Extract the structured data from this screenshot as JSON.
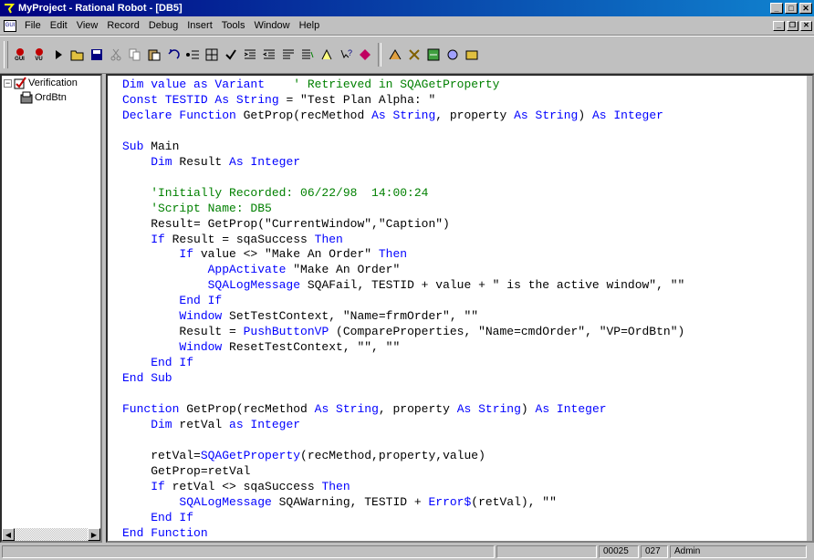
{
  "window": {
    "title": "MyProject - Rational Robot - [DB5]",
    "min_label": "_",
    "max_label": "□",
    "close_label": "✕"
  },
  "menubar": {
    "doc_icon_label": "GUI",
    "items": [
      "File",
      "Edit",
      "View",
      "Record",
      "Debug",
      "Insert",
      "Tools",
      "Window",
      "Help"
    ],
    "mdi_min": "_",
    "mdi_restore": "❐",
    "mdi_close": "✕"
  },
  "toolbar": {
    "gui_label": "GUI",
    "vu_label": "VU"
  },
  "tree": {
    "root": {
      "label": "Verification",
      "expander": "−"
    },
    "child": {
      "label": "OrdBtn"
    }
  },
  "editor": {
    "lines": [
      [
        {
          "t": "Dim value ",
          "c": "kw"
        },
        {
          "t": "as Variant",
          "c": "kw"
        },
        {
          "t": "    ' Retrieved in SQAGetProperty",
          "c": "cm"
        }
      ],
      [
        {
          "t": "Const TESTID ",
          "c": "kw"
        },
        {
          "t": "As String",
          "c": "kw"
        },
        {
          "t": " = \"Test Plan Alpha: \"",
          "c": ""
        }
      ],
      [
        {
          "t": "Declare Function",
          "c": "kw"
        },
        {
          "t": " GetProp(recMethod ",
          "c": ""
        },
        {
          "t": "As String",
          "c": "kw"
        },
        {
          "t": ", property ",
          "c": ""
        },
        {
          "t": "As String",
          "c": "kw"
        },
        {
          "t": ") ",
          "c": ""
        },
        {
          "t": "As Integer",
          "c": "kw"
        }
      ],
      [],
      [
        {
          "t": "Sub",
          "c": "kw"
        },
        {
          "t": " Main",
          "c": ""
        }
      ],
      [
        {
          "t": "    Dim",
          "c": "kw"
        },
        {
          "t": " Result ",
          "c": ""
        },
        {
          "t": "As Integer",
          "c": "kw"
        }
      ],
      [],
      [
        {
          "t": "    'Initially Recorded: 06/22/98  14:00:24",
          "c": "cm"
        }
      ],
      [
        {
          "t": "    'Script Name: DB5",
          "c": "cm"
        }
      ],
      [
        {
          "t": "    Result= GetProp(\"CurrentWindow\",\"Caption\")",
          "c": ""
        }
      ],
      [
        {
          "t": "    If",
          "c": "kw"
        },
        {
          "t": " Result = sqaSuccess ",
          "c": ""
        },
        {
          "t": "Then",
          "c": "kw"
        }
      ],
      [
        {
          "t": "        If",
          "c": "kw"
        },
        {
          "t": " value <> \"Make An Order\" ",
          "c": ""
        },
        {
          "t": "Then",
          "c": "kw"
        }
      ],
      [
        {
          "t": "            AppActivate",
          "c": "kw"
        },
        {
          "t": " \"Make An Order\"",
          "c": ""
        }
      ],
      [
        {
          "t": "            SQALogMessage",
          "c": "kw"
        },
        {
          "t": " SQAFail, TESTID + value + \" is the active window\", \"\"",
          "c": ""
        }
      ],
      [
        {
          "t": "        End If",
          "c": "kw"
        }
      ],
      [
        {
          "t": "        Window",
          "c": "kw"
        },
        {
          "t": " SetTestContext, \"Name=frmOrder\", \"\"",
          "c": ""
        }
      ],
      [
        {
          "t": "        Result = ",
          "c": ""
        },
        {
          "t": "PushButtonVP",
          "c": "kw"
        },
        {
          "t": " (CompareProperties, \"Name=cmdOrder\", \"VP=OrdBtn\")",
          "c": ""
        }
      ],
      [
        {
          "t": "        Window",
          "c": "kw"
        },
        {
          "t": " ResetTestContext, \"\", \"\"",
          "c": ""
        }
      ],
      [
        {
          "t": "    End If",
          "c": "kw"
        }
      ],
      [
        {
          "t": "End Sub",
          "c": "kw"
        }
      ],
      [],
      [
        {
          "t": "Function",
          "c": "kw"
        },
        {
          "t": " GetProp(recMethod ",
          "c": ""
        },
        {
          "t": "As String",
          "c": "kw"
        },
        {
          "t": ", property ",
          "c": ""
        },
        {
          "t": "As String",
          "c": "kw"
        },
        {
          "t": ") ",
          "c": ""
        },
        {
          "t": "As Integer",
          "c": "kw"
        }
      ],
      [
        {
          "t": "    Dim",
          "c": "kw"
        },
        {
          "t": " retVal ",
          "c": ""
        },
        {
          "t": "as Integer",
          "c": "kw"
        }
      ],
      [],
      [
        {
          "t": "    retVal=",
          "c": ""
        },
        {
          "t": "SQAGetProperty",
          "c": "kw"
        },
        {
          "t": "(recMethod,property,value)",
          "c": ""
        }
      ],
      [
        {
          "t": "    GetProp=retVal",
          "c": ""
        }
      ],
      [
        {
          "t": "    If",
          "c": "kw"
        },
        {
          "t": " retVal <> sqaSuccess ",
          "c": ""
        },
        {
          "t": "Then",
          "c": "kw"
        }
      ],
      [
        {
          "t": "        SQALogMessage",
          "c": "kw"
        },
        {
          "t": " SQAWarning, TESTID + ",
          "c": ""
        },
        {
          "t": "Error$",
          "c": "kw"
        },
        {
          "t": "(retVal), \"\"",
          "c": ""
        }
      ],
      [
        {
          "t": "    End If",
          "c": "kw"
        }
      ],
      [
        {
          "t": "End Function",
          "c": "kw"
        }
      ]
    ]
  },
  "statusbar": {
    "line": "00025",
    "col": "027",
    "user": "Admin"
  },
  "colors": {
    "keyword": "#0000ff",
    "comment": "#008000",
    "titlebar": "#000080"
  }
}
